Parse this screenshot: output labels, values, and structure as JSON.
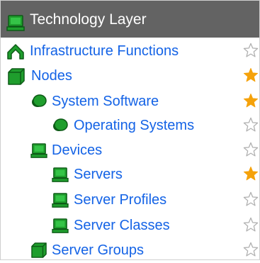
{
  "header": {
    "title": "Technology Layer"
  },
  "items": [
    {
      "label": "Infrastructure Functions",
      "icon": "function-chevron-icon",
      "favorite": false
    },
    {
      "label": "Nodes",
      "icon": "node-cube-icon",
      "favorite": true
    },
    {
      "label": "System Software",
      "icon": "system-software-disc-icon",
      "favorite": true
    },
    {
      "label": "Operating Systems",
      "icon": "system-software-disc-icon",
      "favorite": false
    },
    {
      "label": "Devices",
      "icon": "device-monitor-icon",
      "favorite": false
    },
    {
      "label": "Servers",
      "icon": "device-monitor-icon",
      "favorite": true
    },
    {
      "label": "Server Profiles",
      "icon": "device-monitor-icon",
      "favorite": false
    },
    {
      "label": "Server Classes",
      "icon": "device-monitor-icon",
      "favorite": false
    },
    {
      "label": "Server Groups",
      "icon": "node-cube-icon",
      "favorite": false
    }
  ],
  "colors": {
    "header_bg": "#636363",
    "link": "#1463e6",
    "icon_green": "#1f9e2d",
    "icon_dark": "#0d5a16",
    "star_filled": "#f5a20b",
    "star_outline": "#b0b0b0"
  }
}
